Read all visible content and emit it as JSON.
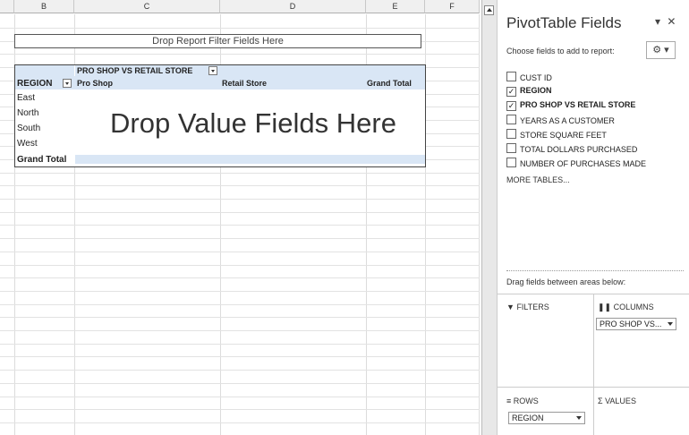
{
  "columns": [
    "B",
    "C",
    "D",
    "E",
    "F"
  ],
  "pivot": {
    "filter_drop": "Drop Report Filter Fields Here",
    "column_field": "PRO SHOP VS RETAIL STORE",
    "row_header": "REGION",
    "col_items": [
      "Pro Shop",
      "Retail Store",
      "Grand Total"
    ],
    "row_items": [
      "East",
      "North",
      "South",
      "West"
    ],
    "grand_total": "Grand Total",
    "value_drop": "Drop Value Fields Here"
  },
  "panel": {
    "title": "PivotTable Fields",
    "choose_label": "Choose fields to add to report:",
    "gear_label": "⚙ ▾",
    "fields": [
      {
        "name": "CUST ID",
        "checked": false
      },
      {
        "name": "REGION",
        "checked": true
      },
      {
        "name": "PRO SHOP VS RETAIL STORE",
        "checked": true
      },
      {
        "name": "YEARS AS A CUSTOMER",
        "checked": false
      },
      {
        "name": "STORE SQUARE FEET",
        "checked": false
      },
      {
        "name": "TOTAL DOLLARS PURCHASED",
        "checked": false
      },
      {
        "name": "NUMBER OF PURCHASES MADE",
        "checked": false
      }
    ],
    "more_tables": "MORE TABLES...",
    "drag_label": "Drag fields between areas below:",
    "areas": {
      "filters": "FILTERS",
      "columns": "COLUMNS",
      "rows": "ROWS",
      "values": "VALUES"
    },
    "columns_item": "PRO SHOP VS...",
    "rows_item": "REGION"
  }
}
